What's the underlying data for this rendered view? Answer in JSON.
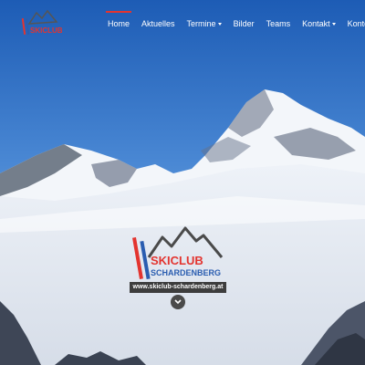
{
  "header": {
    "logo_text": "SKICLUB",
    "nav": [
      {
        "label": "Home",
        "active": true,
        "has_dropdown": false
      },
      {
        "label": "Aktuelles",
        "active": false,
        "has_dropdown": false
      },
      {
        "label": "Termine",
        "active": false,
        "has_dropdown": true
      },
      {
        "label": "Bilder",
        "active": false,
        "has_dropdown": false
      },
      {
        "label": "Teams",
        "active": false,
        "has_dropdown": false
      },
      {
        "label": "Kontakt",
        "active": false,
        "has_dropdown": true
      },
      {
        "label": "Konto",
        "active": false,
        "has_dropdown": true
      }
    ]
  },
  "hero": {
    "logo_line1": "SKICLUB",
    "logo_line2": "SCHARDENBERG",
    "url": "www.skiclub-schardenberg.at",
    "scroll_icon": "chevron-down-icon"
  },
  "colors": {
    "accent_red": "#e3342f",
    "brand_blue": "#2a5db0",
    "sky_top": "#1f5fb8",
    "sky_bottom": "#8fbde8"
  }
}
